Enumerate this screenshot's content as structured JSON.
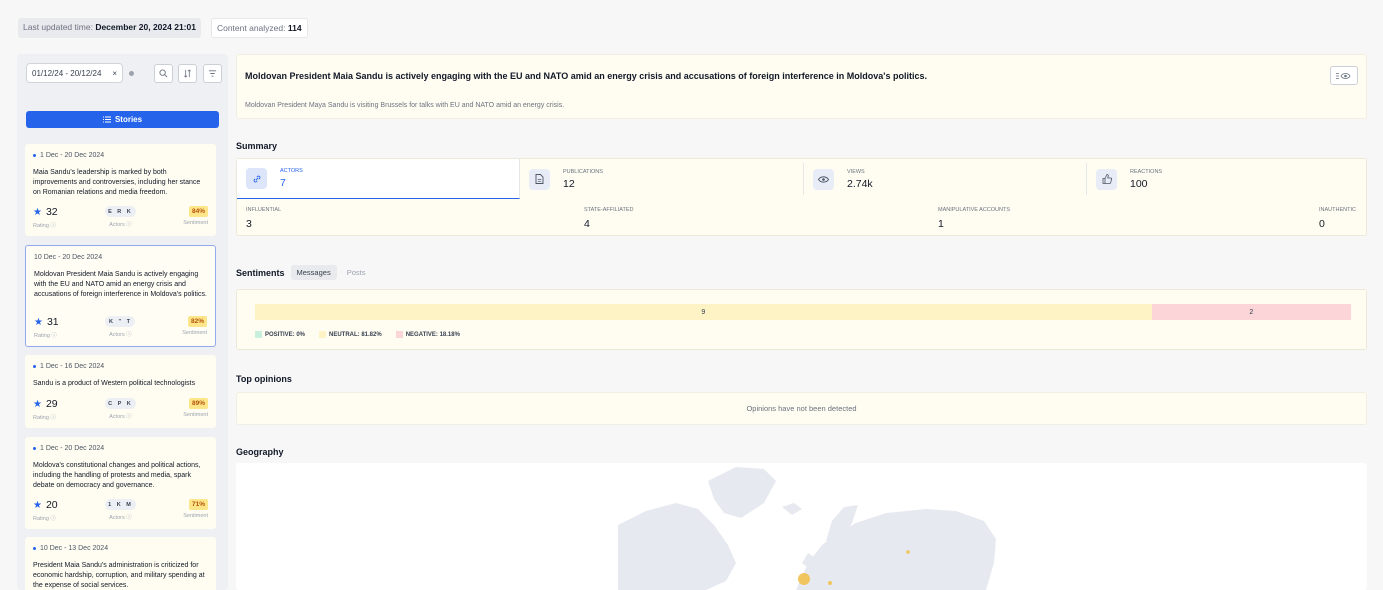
{
  "topbar": {
    "updated_label": "Last updated time:",
    "updated_value": "December 20, 2024 21:01",
    "content_label": "Content analyzed:",
    "content_value": "114"
  },
  "filter": {
    "date_range": "01/12/24 - 20/12/24",
    "clear": "×"
  },
  "sidebar": {
    "stories_label": "Stories",
    "rating_label": "Rating ⓘ",
    "actors_label": "Actors ⓘ",
    "sentiment_label": "Sentiment",
    "stories": [
      {
        "date": "1 Dec - 20 Dec 2024",
        "text": "Maia Sandu's leadership is marked by both improvements and controversies, including her stance on Romanian relations and media freedom.",
        "rating": "32",
        "actors": "E R K",
        "sentiment": "84%"
      },
      {
        "date": "10 Dec - 20 Dec 2024",
        "text": "Moldovan President Maia Sandu is actively engaging with the EU and NATO amid an energy crisis and accusations of foreign interference in Moldova's politics.",
        "rating": "31",
        "actors": "K \" T",
        "sentiment": "82%"
      },
      {
        "date": "1 Dec - 16 Dec 2024",
        "text": "Sandu is a product of Western political technologists",
        "rating": "29",
        "actors": "C P K",
        "sentiment": "89%"
      },
      {
        "date": "1 Dec - 20 Dec 2024",
        "text": "Moldova's constitutional changes and political actions, including the handling of protests and media, spark debate on democracy and governance.",
        "rating": "20",
        "actors": "1 K M",
        "sentiment": "71%"
      },
      {
        "date": "10 Dec - 13 Dec 2024",
        "text": "President Maia Sandu's administration is criticized for economic hardship, corruption, and military spending at the expense of social services."
      }
    ]
  },
  "headline": {
    "title": "Moldovan President Maia Sandu is actively engaging with the EU and NATO amid an energy crisis and accusations of foreign interference in Moldova's politics.",
    "description": "Moldovan President Maya Sandu is visiting Brussels for talks with EU and NATO amid an energy crisis."
  },
  "summary": {
    "title": "Summary",
    "actors_label": "ACTORS",
    "actors_value": "7",
    "publications_label": "PUBLICATIONS",
    "publications_value": "12",
    "views_label": "VIEWS",
    "views_value": "2.74k",
    "reactions_label": "REACTIONS",
    "reactions_value": "100",
    "influential_label": "INFLUENTIAL",
    "influential_value": "3",
    "state_label": "STATE-AFFILIATED",
    "state_value": "4",
    "manipulative_label": "MANIPULATIVE ACCOUNTS",
    "manipulative_value": "1",
    "inauthentic_label": "INAUTHENTIC",
    "inauthentic_value": "0"
  },
  "sentiments": {
    "title": "Sentiments",
    "tab_messages": "Messages",
    "tab_posts": "Posts",
    "neutral_count": "9",
    "negative_count": "2",
    "neutral_fraction": 0.8182,
    "negative_fraction": 0.1818,
    "legend_positive": "POSITIVE: 0%",
    "legend_neutral": "NEUTRAL: 81.82%",
    "legend_negative": "NEGATIVE: 18.18%",
    "colors": {
      "positive": "#c8eedd",
      "neutral": "#fdf3c4",
      "negative": "#fbd5d8"
    }
  },
  "opinions": {
    "title": "Top opinions",
    "empty": "Opinions have not been detected"
  },
  "geography": {
    "title": "Geography"
  },
  "colors": {
    "accent": "#2563eb"
  }
}
